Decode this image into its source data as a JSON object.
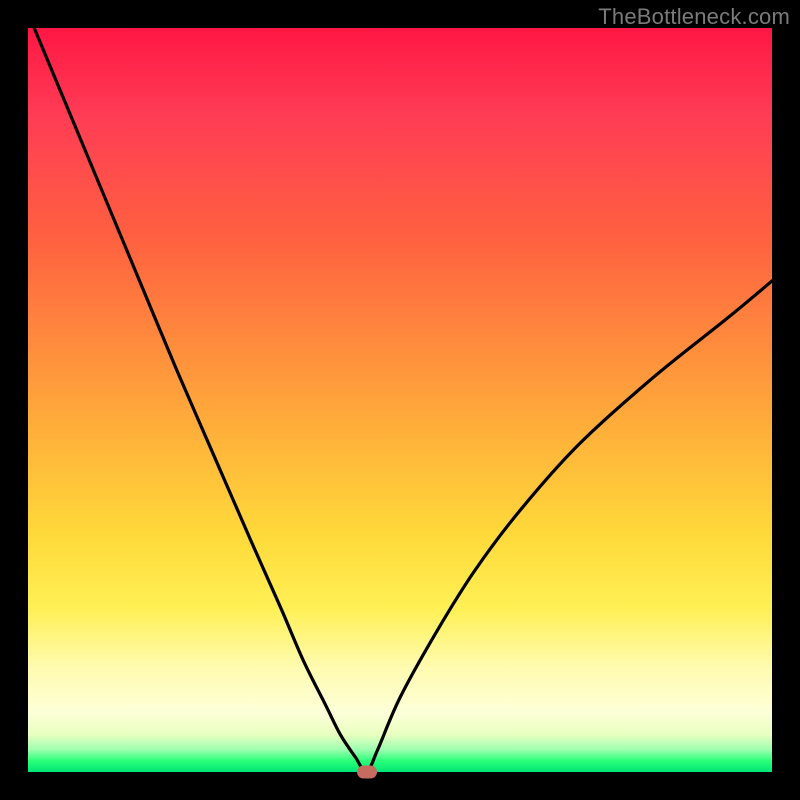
{
  "watermark": "TheBottleneck.com",
  "chart_data": {
    "type": "line",
    "title": "",
    "xlabel": "",
    "ylabel": "",
    "xlim": [
      0,
      100
    ],
    "ylim": [
      0,
      100
    ],
    "grid": false,
    "series": [
      {
        "name": "bottleneck-curve",
        "x": [
          0,
          5,
          10,
          15,
          20,
          25,
          30,
          34,
          37,
          40,
          42,
          44,
          45.5,
          47,
          50,
          55,
          60,
          66,
          74,
          84,
          94,
          100
        ],
        "values": [
          102,
          90,
          78,
          66,
          54,
          42.5,
          31,
          22,
          15,
          9,
          5,
          2,
          0,
          3,
          10,
          19,
          27,
          35,
          44,
          53,
          61,
          66
        ]
      }
    ],
    "marker": {
      "x": 45.5,
      "y": 0
    },
    "background_gradient": {
      "top": "#ff1744",
      "mid": "#ffd93a",
      "bottom": "#00e676"
    }
  }
}
